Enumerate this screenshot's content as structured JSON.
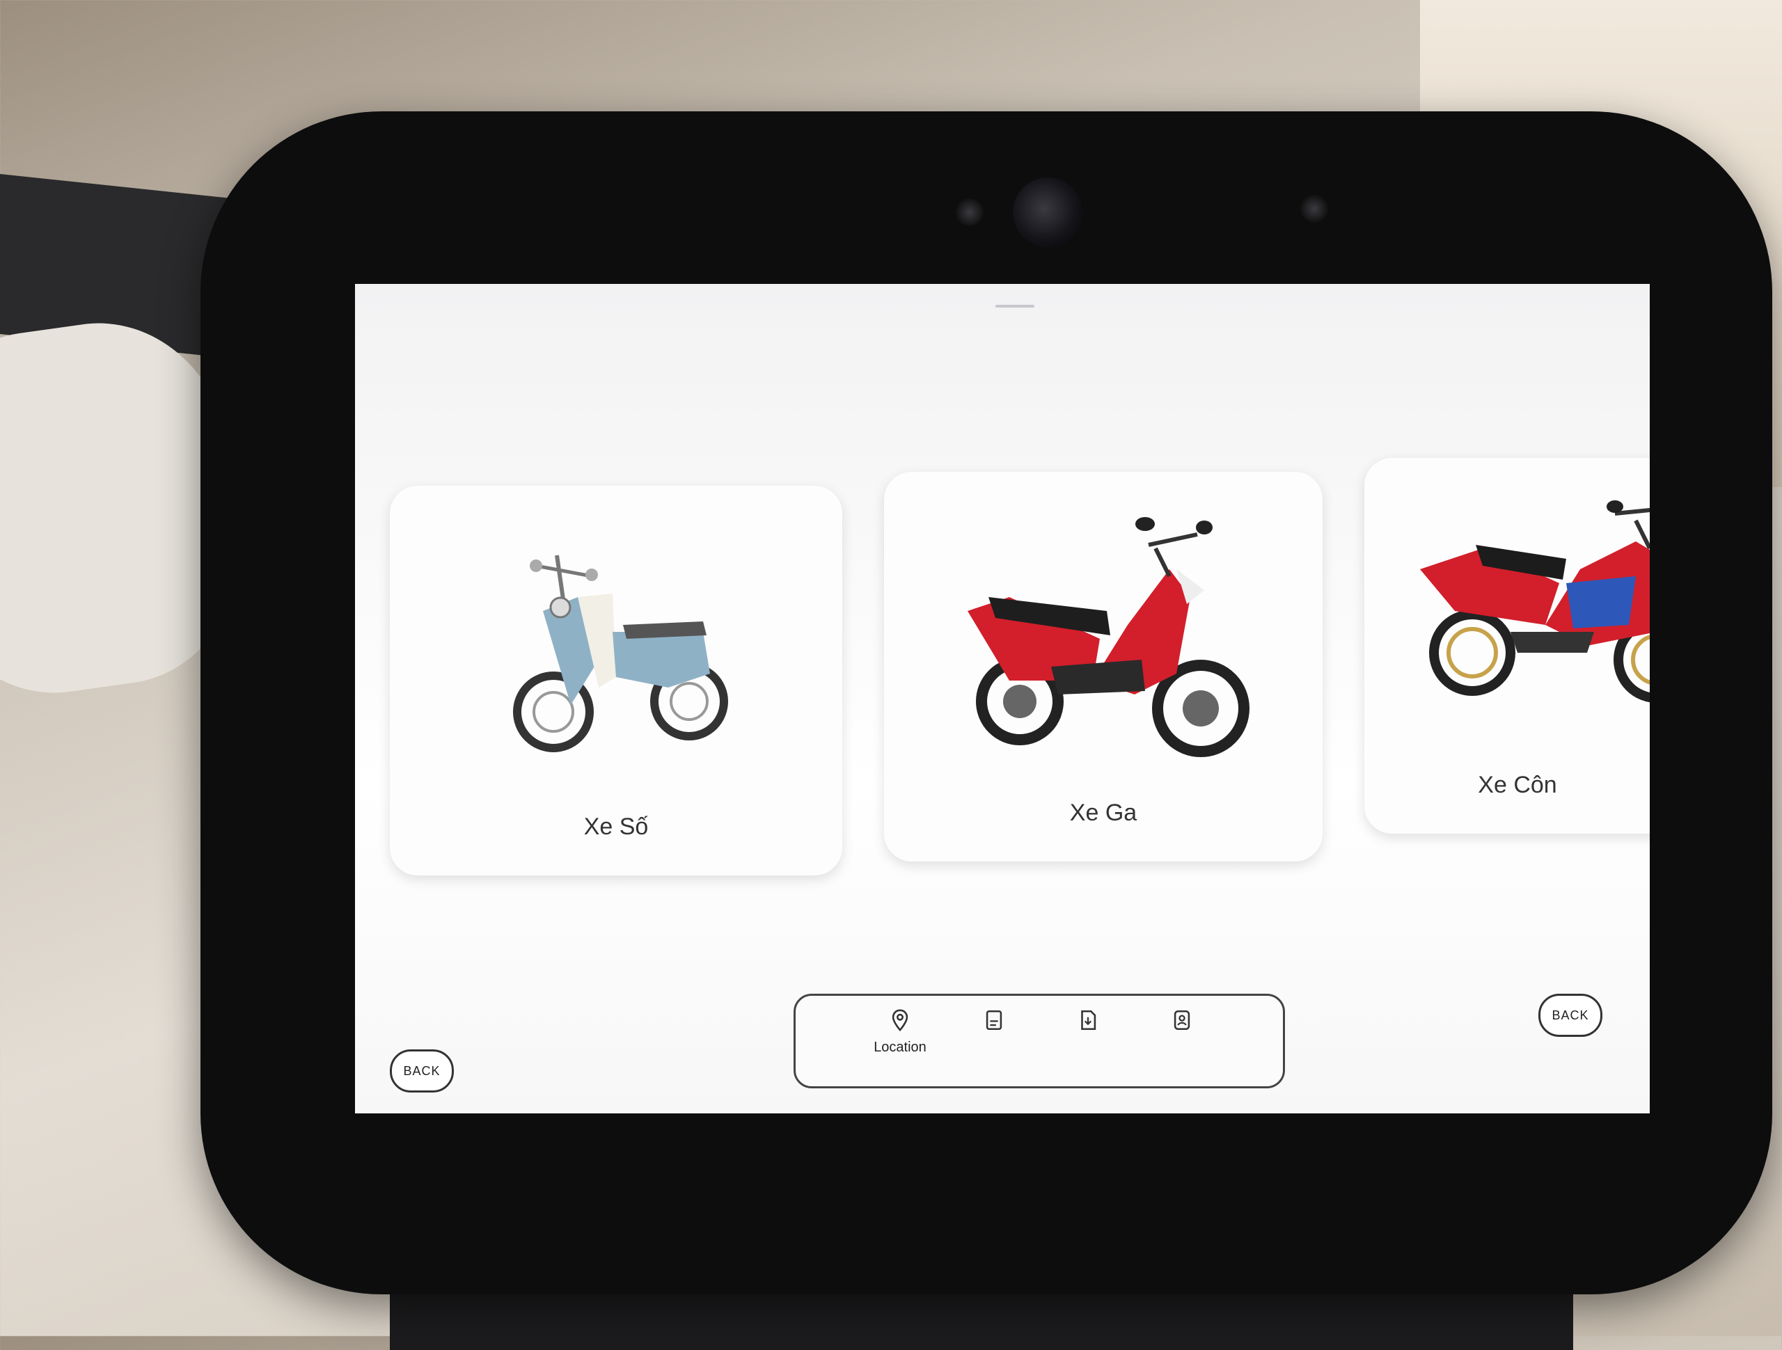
{
  "categories": [
    {
      "label": "Xe Số",
      "image": "blue-underbone-motorbike"
    },
    {
      "label": "Xe Ga",
      "image": "red-scooter"
    },
    {
      "label": "Xe Côn",
      "image": "red-blue-sport-motorbike"
    }
  ],
  "nav": {
    "items": [
      {
        "icon": "location-pin-icon",
        "label": "Location"
      },
      {
        "icon": "document-icon",
        "label": ""
      },
      {
        "icon": "file-download-icon",
        "label": ""
      },
      {
        "icon": "contact-card-icon",
        "label": ""
      }
    ]
  },
  "back": {
    "left_label": "BACK",
    "right_label": "BACK"
  },
  "colors": {
    "screen_bg": "#ffffff",
    "device": "#0d0d0e",
    "accent_red": "#d21f2b",
    "bike_blue": "#8fb1c6"
  }
}
